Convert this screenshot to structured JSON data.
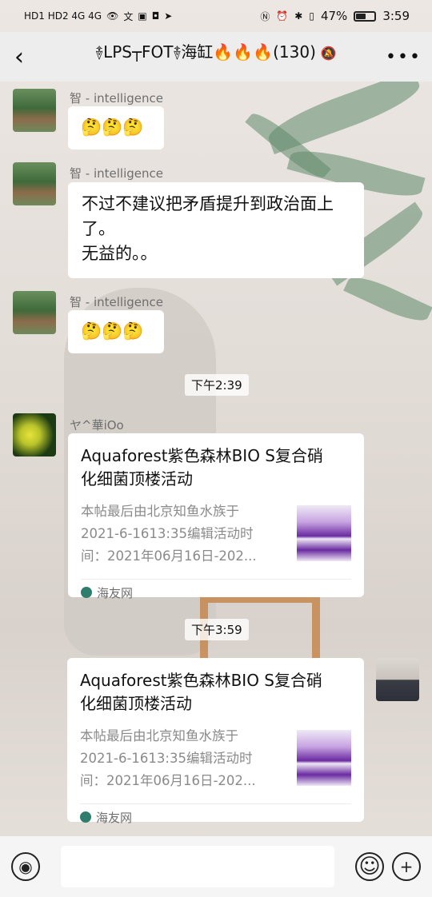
{
  "status_bar": {
    "left_indicators": "HD1 HD2 4G 4G",
    "percent": "47%",
    "battery_level": 0.47,
    "time": "3:59"
  },
  "header": {
    "back_icon": "chevron-left-icon",
    "title": "࿈LPS┬FOT࿈海缸🔥🔥🔥(130)",
    "mute_icon": "bell-off-icon",
    "more_icon": "more-icon"
  },
  "messages": [
    {
      "sender": "智 - intelligence",
      "text": "🤔🤔🤔"
    },
    {
      "sender": "智 - intelligence",
      "line1": "不过不建议把矛盾提升到政治面上",
      "line2": "了。",
      "line3": "无益的。。"
    },
    {
      "sender": "智 - intelligence",
      "text": "🤔🤔🤔"
    }
  ],
  "time_1": "下午2:39",
  "card_1": {
    "sender": "ヤ^華iOo",
    "title_l1": "Aquaforest紫色森林BIO S复合硝",
    "title_l2": "化细菌顶楼活动",
    "desc_l1": "本帖最后由北京知鱼水族于",
    "desc_l2": "2021-6-1613:35编辑活动时",
    "desc_l3": "间：2021年06月16日-202...",
    "source": "海友网"
  },
  "time_2": "下午3:59",
  "card_2": {
    "title_l1": "Aquaforest紫色森林BIO S复合硝",
    "title_l2": "化细菌顶楼活动",
    "desc_l1": "本帖最后由北京知鱼水族于",
    "desc_l2": "2021-6-1613:35编辑活动时",
    "desc_l3": "间：2021年06月16日-202...",
    "source": "海友网"
  },
  "input_bar": {
    "voice_icon": "voice-icon",
    "emoji_icon": "emoji-icon",
    "plus_icon": "plus-icon",
    "text_value": ""
  }
}
